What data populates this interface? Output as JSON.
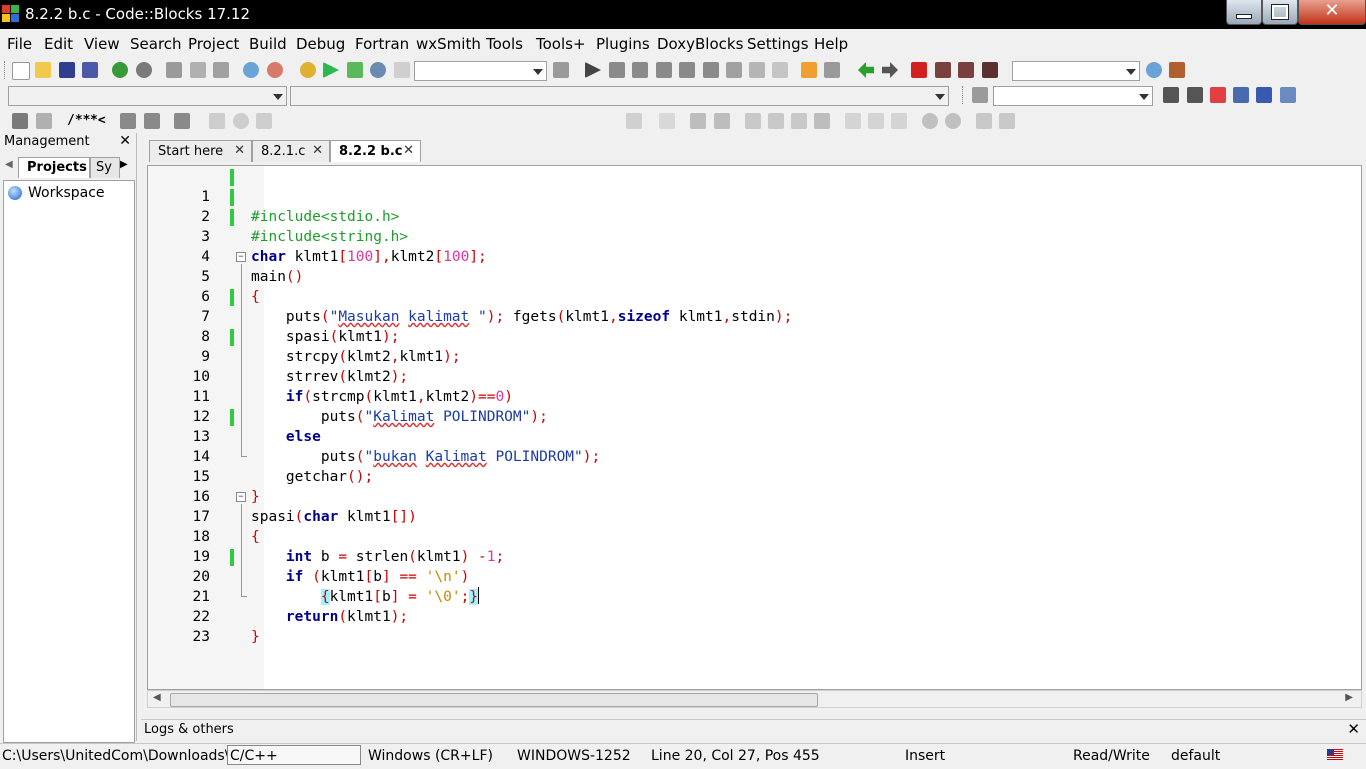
{
  "window": {
    "title": "8.2.2 b.c - Code::Blocks 17.12",
    "close_glyph": "✕"
  },
  "menu": [
    "File",
    "Edit",
    "View",
    "Search",
    "Project",
    "Build",
    "Debug",
    "Fortran",
    "wxSmith",
    "Tools",
    "Tools+",
    "Plugins",
    "DoxyBlocks",
    "Settings",
    "Help"
  ],
  "toolbar": {
    "doxy_comment": "/**",
    "doxy_line": "*<"
  },
  "management": {
    "title": "Management",
    "close_glyph": "✕",
    "tabs": [
      "Projects",
      "Sy"
    ],
    "tree": {
      "root": "Workspace"
    }
  },
  "editor": {
    "tabs": [
      {
        "label": "Start here",
        "close": "✕",
        "active": false
      },
      {
        "label": "8.2.1.c",
        "close": "✕",
        "active": false
      },
      {
        "label": "8.2.2 b.c",
        "close": "✕",
        "active": true
      }
    ],
    "lines": [
      {
        "n": "1"
      },
      {
        "n": "2"
      },
      {
        "n": "3"
      },
      {
        "n": "4"
      },
      {
        "n": "5"
      },
      {
        "n": "6"
      },
      {
        "n": "7"
      },
      {
        "n": "8"
      },
      {
        "n": "9"
      },
      {
        "n": "10"
      },
      {
        "n": "11"
      },
      {
        "n": "12"
      },
      {
        "n": "13"
      },
      {
        "n": "14"
      },
      {
        "n": "15"
      },
      {
        "n": "16"
      },
      {
        "n": "17"
      },
      {
        "n": "18"
      },
      {
        "n": "19"
      },
      {
        "n": "20"
      },
      {
        "n": "21"
      },
      {
        "n": "22"
      },
      {
        "n": "23"
      }
    ],
    "code": {
      "l1": "#include<stdio.h>",
      "l2": "#include<string.h>",
      "l3a": "char",
      "l3b": " klmt1",
      "l3c": "[",
      "l3d": "100",
      "l3e": "],",
      "l3f": "klmt2",
      "l3g": "[",
      "l3h": "100",
      "l3i": "];",
      "l4a": "main",
      "l4b": "()",
      "l5": "{",
      "l6a": "    puts",
      "l6b": "(",
      "l6c": "\"",
      "l6d": "Masukan",
      "l6e": " ",
      "l6f": "kalimat",
      "l6g": " \"",
      "l6h": ");",
      "l6i": " fgets",
      "l6j": "(",
      "l6k": "klmt1",
      "l6l": ",",
      "l6m": "sizeof",
      "l6n": " klmt1",
      "l6o": ",",
      "l6p": "stdin",
      "l6q": ");",
      "l7a": "    spasi",
      "l7b": "(",
      "l7c": "klmt1",
      "l7d": ");",
      "l8a": "    strcpy",
      "l8b": "(",
      "l8c": "klmt2",
      "l8d": ",",
      "l8e": "klmt1",
      "l8f": ");",
      "l9a": "    strrev",
      "l9b": "(",
      "l9c": "klmt2",
      "l9d": ");",
      "l10a": "    ",
      "l10b": "if",
      "l10c": "(",
      "l10d": "strcmp",
      "l10e": "(",
      "l10f": "klmt1",
      "l10g": ",",
      "l10h": "klmt2",
      "l10i": ")==",
      "l10j": "0",
      "l10k": ")",
      "l11a": "        puts",
      "l11b": "(",
      "l11c": "\"",
      "l11d": "Kalimat",
      "l11e": " POLINDROM\"",
      "l11f": ");",
      "l12a": "    ",
      "l12b": "else",
      "l13a": "        puts",
      "l13b": "(",
      "l13c": "\"",
      "l13d": "bukan",
      "l13e": " ",
      "l13f": "Kalimat",
      "l13g": " POLINDROM\"",
      "l13h": ");",
      "l14a": "    getchar",
      "l14b": "();",
      "l15": "}",
      "l16a": "spasi",
      "l16b": "(",
      "l16c": "char",
      "l16d": " klmt1",
      "l16e": "[])",
      "l17": "{",
      "l18a": "    ",
      "l18b": "int",
      "l18c": " b ",
      "l18d": "=",
      "l18e": " strlen",
      "l18f": "(",
      "l18g": "klmt1",
      "l18h": ")",
      "l18i": " -",
      "l18j": "1",
      "l18k": ";",
      "l19a": "    ",
      "l19b": "if",
      "l19c": " (",
      "l19d": "klmt1",
      "l19e": "[",
      "l19f": "b",
      "l19g": "]",
      "l19h": " == ",
      "l19i": "'\\n'",
      "l19j": ")",
      "l20a": "        ",
      "l20b": "{",
      "l20c": "klmt1",
      "l20d": "[",
      "l20e": "b",
      "l20f": "]",
      "l20g": " = ",
      "l20h": "'\\0'",
      "l20i": ";",
      "l20j": "}",
      "l21a": "    ",
      "l21b": "return",
      "l21c": "(",
      "l21d": "klmt1",
      "l21e": ");",
      "l22": "}"
    }
  },
  "logs": {
    "title": "Logs & others",
    "close_glyph": "✕"
  },
  "status": {
    "path": "C:\\Users\\UnitedCom\\Downloads\\",
    "language": "C/C++",
    "eol": "Windows (CR+LF)",
    "encoding": "WINDOWS-1252",
    "position": "Line 20, Col 27, Pos 455",
    "mode": "Insert",
    "access": "Read/Write",
    "profile": "default"
  }
}
